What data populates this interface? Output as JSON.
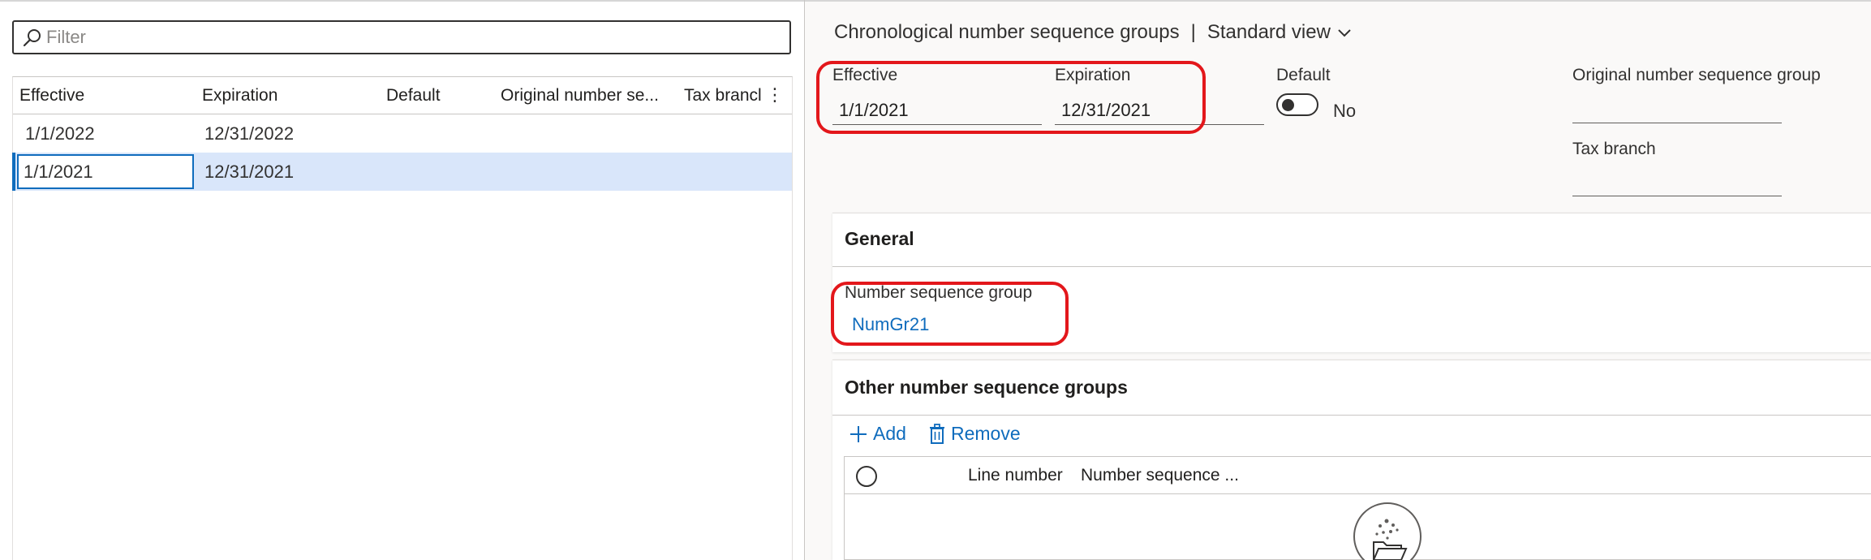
{
  "filter": {
    "placeholder": "Filter"
  },
  "list": {
    "columns": [
      "Effective",
      "Expiration",
      "Default",
      "Original number se...",
      "Tax brancl"
    ],
    "rows": [
      {
        "effective": "1/1/2022",
        "expiration": "12/31/2022",
        "selected": false
      },
      {
        "effective": "1/1/2021",
        "expiration": "12/31/2021",
        "selected": true
      }
    ]
  },
  "detail": {
    "caption": "Chronological number sequence groups",
    "separator": "|",
    "view": "Standard view",
    "effective_label": "Effective",
    "effective_value": "1/1/2021",
    "expiration_label": "Expiration",
    "expiration_value": "12/31/2021",
    "default_label": "Default",
    "default_value": "No",
    "original_label": "Original number sequence group",
    "tax_branch_label": "Tax branch"
  },
  "general": {
    "title": "General",
    "numseq_label": "Number sequence group",
    "numseq_value": "NumGr21"
  },
  "other": {
    "title": "Other number sequence groups",
    "add_label": "Add",
    "remove_label": "Remove",
    "columns": [
      "Line number",
      "Number sequence ..."
    ]
  },
  "colors": {
    "accent": "#0f6cbd",
    "highlight": "#e3171b",
    "selected_row": "#d9e6fa"
  },
  "icons": [
    "search-icon",
    "more-vertical-icon",
    "chevron-down-icon",
    "add-icon",
    "trash-icon",
    "empty-folder-icon",
    "splitter-grip-icon"
  ]
}
